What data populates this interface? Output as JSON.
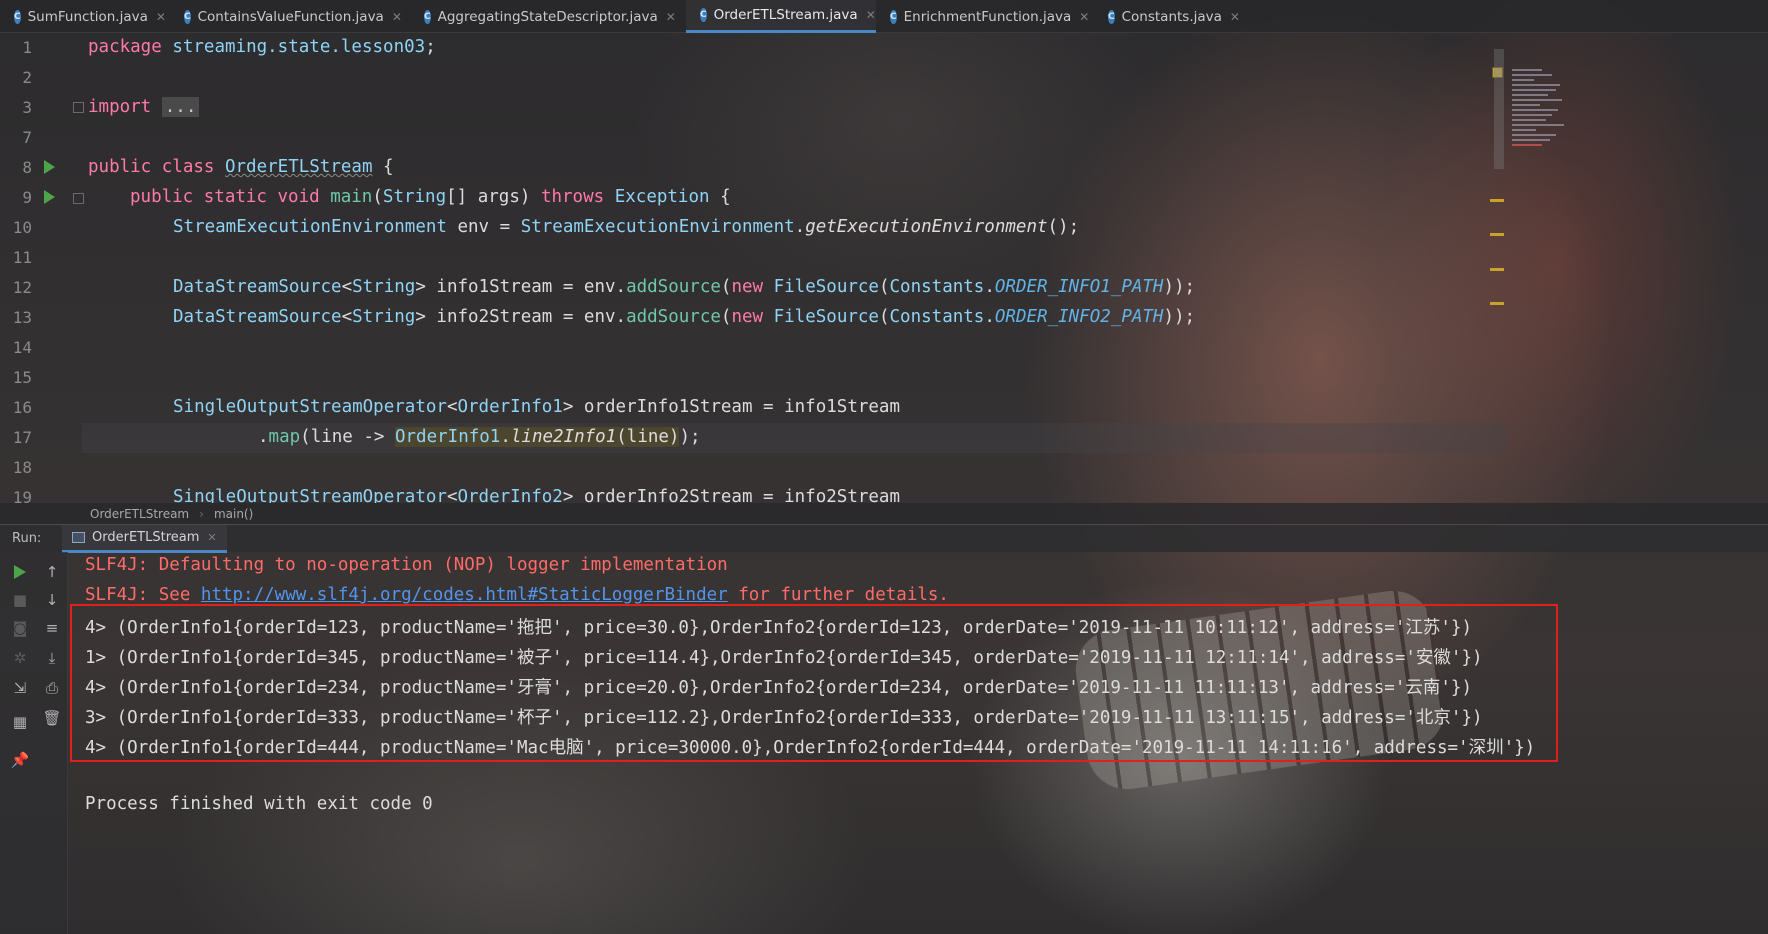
{
  "tabs": [
    {
      "label": "SumFunction.java",
      "active": false
    },
    {
      "label": "ContainsValueFunction.java",
      "active": false
    },
    {
      "label": "AggregatingStateDescriptor.java",
      "active": false
    },
    {
      "label": "OrderETLStream.java",
      "active": true
    },
    {
      "label": "EnrichmentFunction.java",
      "active": false
    },
    {
      "label": "Constants.java",
      "active": false
    }
  ],
  "tab_icon_letter": "C",
  "editor": {
    "line_numbers": [
      "1",
      "2",
      "3",
      "7",
      "8",
      "9",
      "10",
      "11",
      "12",
      "13",
      "14",
      "15",
      "16",
      "17",
      "18",
      "19"
    ],
    "line1": {
      "kw": "package",
      "pkg": "streaming.state.lesson03",
      "end": ";"
    },
    "line3": {
      "kw": "import",
      "folded": "..."
    },
    "line8": {
      "kw": "public class",
      "name": "OrderETLStream",
      "end": " {"
    },
    "line9": {
      "kw1": "public static void",
      "name": "main",
      "p1": "(",
      "type": "String",
      "p2": "[] args) ",
      "kw2": "throws",
      "exc": "Exception",
      "end": " {"
    },
    "line10": {
      "type": "StreamExecutionEnvironment",
      "var": " env = ",
      "type2": "StreamExecutionEnvironment",
      "dot": ".",
      "call": "getExecutionEnvironment",
      "end": "();"
    },
    "line12": {
      "type": "DataStreamSource",
      "lt": "<",
      "gen": "String",
      "gt": ">",
      "var": " info1Stream = env.",
      "call": "addSource",
      "p": "(",
      "kw": "new",
      "cls": "FileSource",
      "p2": "(",
      "c": "Constants",
      "dot": ".",
      "const": "ORDER_INFO1_PATH",
      "end": "));"
    },
    "line13": {
      "type": "DataStreamSource",
      "lt": "<",
      "gen": "String",
      "gt": ">",
      "var": " info2Stream = env.",
      "call": "addSource",
      "p": "(",
      "kw": "new",
      "cls": "FileSource",
      "p2": "(",
      "c": "Constants",
      "dot": ".",
      "const": "ORDER_INFO2_PATH",
      "end": "));"
    },
    "line16": {
      "type": "SingleOutputStreamOperator",
      "lt": "<",
      "gen": "OrderInfo1",
      "gt": ">",
      "rest": " orderInfo1Stream = info1Stream"
    },
    "line17": {
      "dot": ".",
      "call": "map",
      "p": "(line -> ",
      "cls": "OrderInfo1",
      "dot2": ".",
      "method": "line2Info1",
      "arg": "(line)",
      "end": ");"
    },
    "line19": {
      "type": "SingleOutputStreamOperator",
      "lt": "<",
      "gen": "OrderInfo2",
      "gt": ">",
      "rest": " orderInfo2Stream = info2Stream"
    }
  },
  "breadcrumb": [
    "OrderETLStream",
    "main()"
  ],
  "run_panel": {
    "label": "Run:",
    "tab": "OrderETLStream"
  },
  "console": {
    "slf1": "SLF4J: Defaulting to no-operation (NOP) logger implementation",
    "slf2_prefix": "SLF4J: See ",
    "slf2_link": "http://www.slf4j.org/codes.html#StaticLoggerBinder",
    "slf2_suffix": " for further details.",
    "results": [
      "4> (OrderInfo1{orderId=123, productName='拖把', price=30.0},OrderInfo2{orderId=123, orderDate='2019-11-11 10:11:12', address='江苏'})",
      "1> (OrderInfo1{orderId=345, productName='被子', price=114.4},OrderInfo2{orderId=345, orderDate='2019-11-11 12:11:14', address='安徽'})",
      "4> (OrderInfo1{orderId=234, productName='牙膏', price=20.0},OrderInfo2{orderId=234, orderDate='2019-11-11 11:11:13', address='云南'})",
      "3> (OrderInfo1{orderId=333, productName='杯子', price=112.2},OrderInfo2{orderId=333, orderDate='2019-11-11 13:11:15', address='北京'})",
      "4> (OrderInfo1{orderId=444, productName='Mac电脑', price=30000.0},OrderInfo2{orderId=444, orderDate='2019-11-11 14:11:16', address='深圳'})"
    ],
    "exit": "Process finished with exit code 0"
  },
  "colors": {
    "accent": "#4a88c7",
    "run_green": "#4da449",
    "error": "#ff6b68",
    "highlight_border": "#e0201a"
  }
}
